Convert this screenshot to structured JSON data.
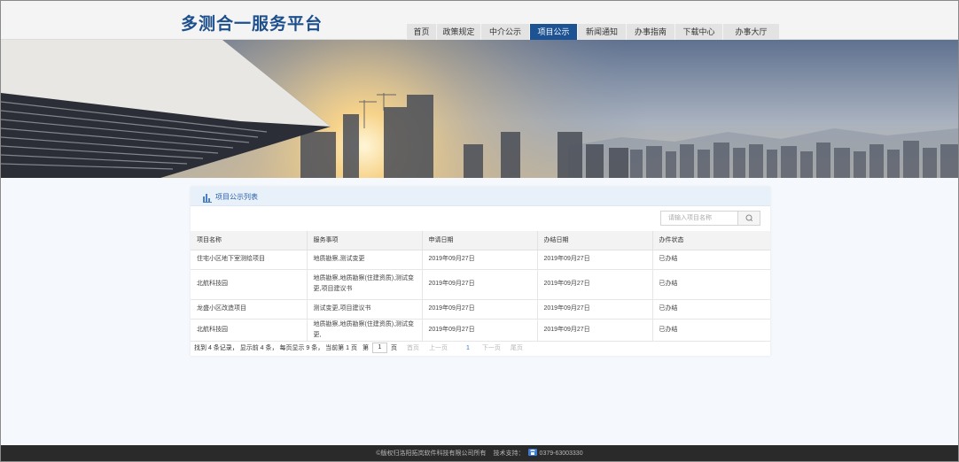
{
  "header": {
    "site_title": "多测合一服务平台",
    "nav": [
      {
        "label": "首页",
        "active": false
      },
      {
        "label": "政策规定",
        "active": false
      },
      {
        "label": "中介公示",
        "active": false
      },
      {
        "label": "项目公示",
        "active": true
      },
      {
        "label": "新闻通知",
        "active": false
      },
      {
        "label": "办事指南",
        "active": false
      },
      {
        "label": "下载中心",
        "active": false
      },
      {
        "label": "办事大厅",
        "active": false
      }
    ]
  },
  "panel": {
    "title": "项目公示列表",
    "search_placeholder": "请输入项目名称",
    "columns": [
      "项目名称",
      "服务事项",
      "申请日期",
      "办结日期",
      "办件状态"
    ],
    "rows": [
      {
        "name": "住宅小区地下室测绘项目",
        "service": "地质勘察,测试变更",
        "apply_date": "2019年09月27日",
        "finish_date": "2019年09月27日",
        "status": "已办结"
      },
      {
        "name": "北航科技园",
        "service": "地质勘察,地质勘察(住建资质),测试变更,项目建议书",
        "apply_date": "2019年09月27日",
        "finish_date": "2019年09月27日",
        "status": "已办结"
      },
      {
        "name": "龙盛小区改造项目",
        "service": "测试变更,项目建议书",
        "apply_date": "2019年09月27日",
        "finish_date": "2019年09月27日",
        "status": "已办结"
      },
      {
        "name": "北航科技园",
        "service": "地质勘察,地质勘察(住建资质),测试变更,",
        "apply_date": "2019年09月27日",
        "finish_date": "2019年09月27日",
        "status": "已办结"
      }
    ]
  },
  "pager": {
    "summary": "找到 4 条记录， 显示前 4 条， 每页显示 9 条， 当前第 1 页",
    "jump_prefix": "第",
    "jump_value": "1",
    "jump_suffix": "页",
    "first": "首页",
    "prev": "上一页",
    "current": "1",
    "next": "下一页",
    "last": "尾页"
  },
  "footer": {
    "copyright": "©版权归洛阳拓岚软件科技有限公司所有",
    "support_label": "技术支持：",
    "phone": "0379-63003330"
  },
  "colors": {
    "brand": "#1c4f8c",
    "nav_active": "#1d5393",
    "panel_head": "#e8f0fa",
    "link": "#2a7ad6",
    "footer_bg": "#2a2a2a"
  }
}
